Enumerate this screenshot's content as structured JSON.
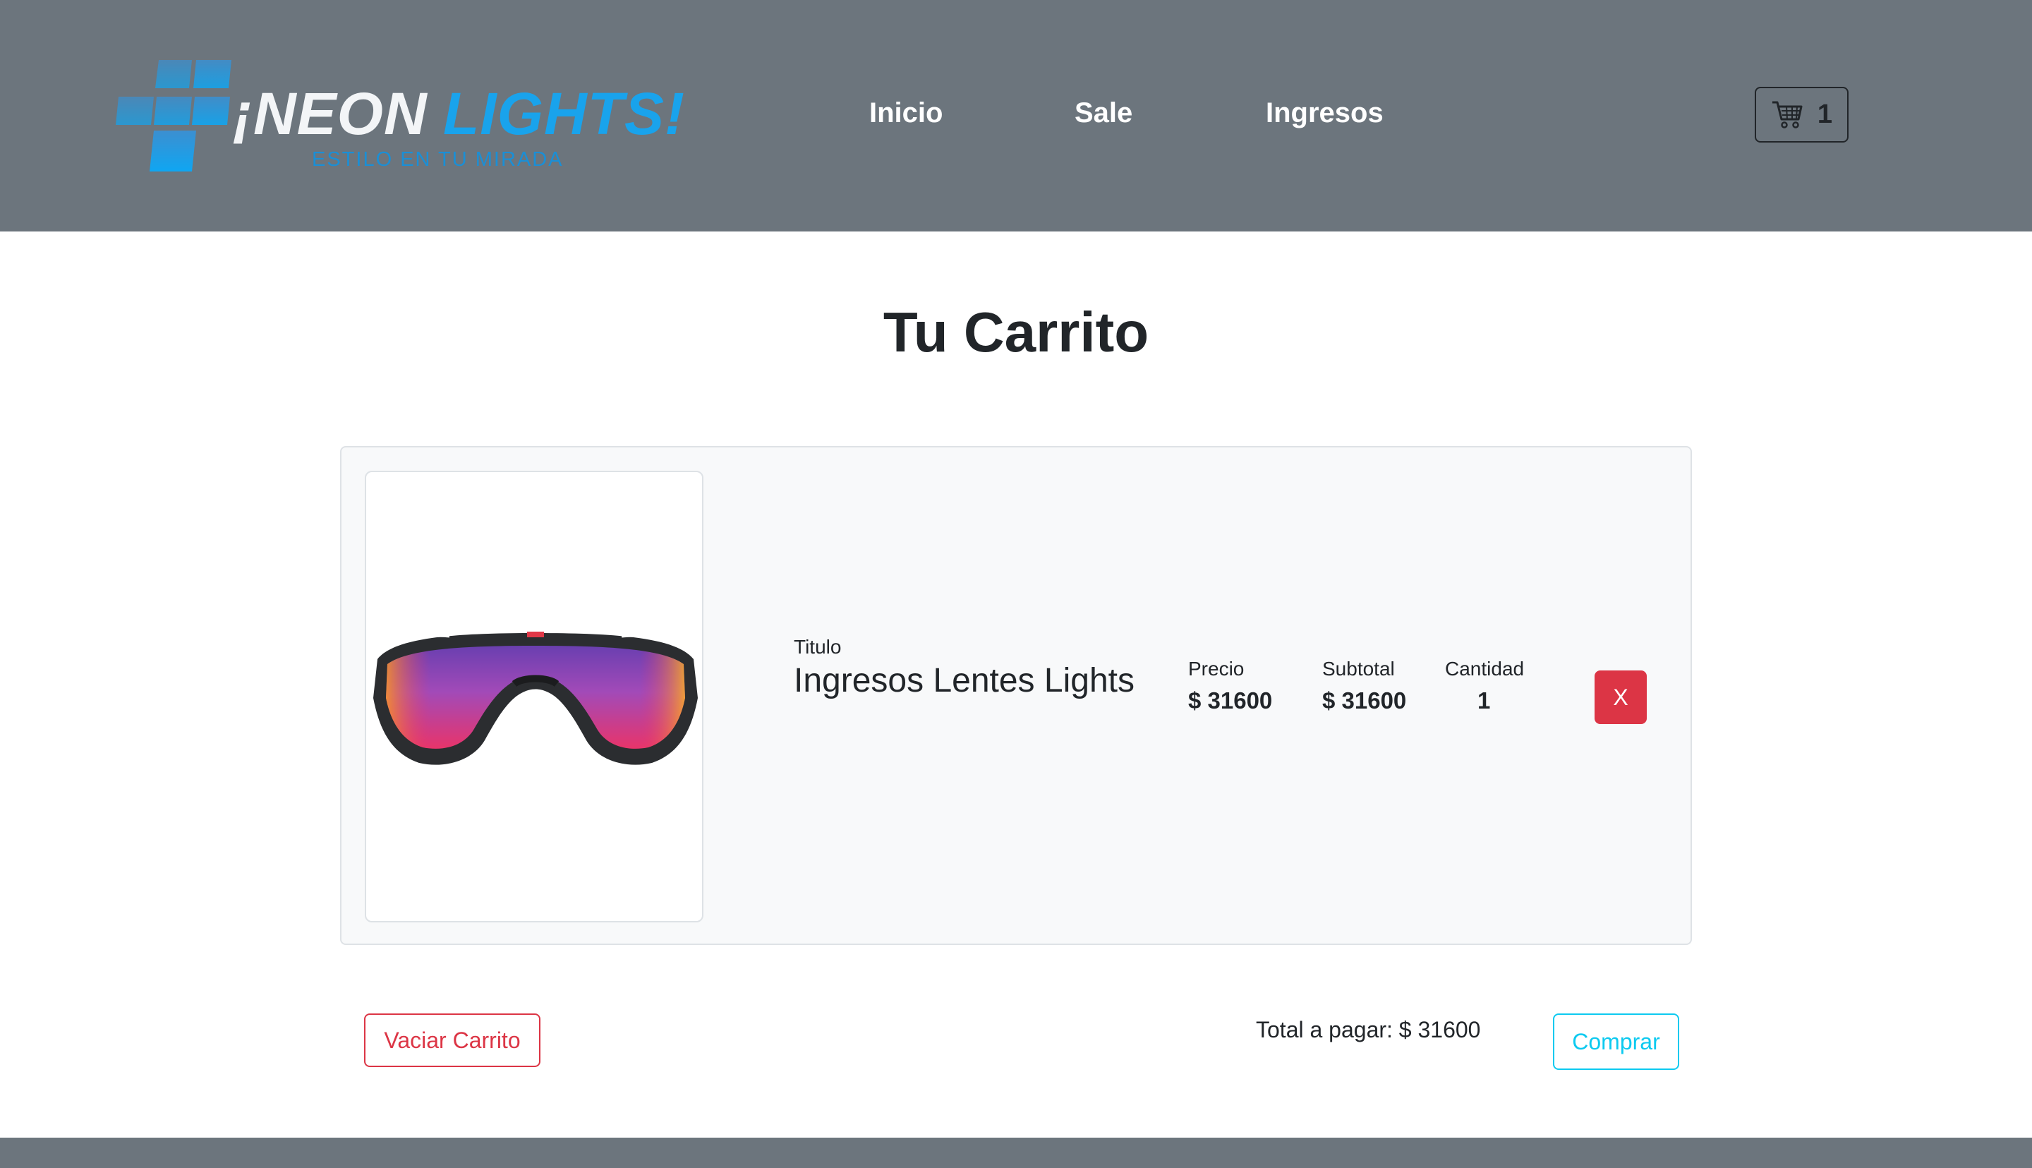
{
  "colors": {
    "navbar_bg": "#6c757d",
    "brand_blue": "#19a3ec",
    "danger": "#dc3545",
    "info": "#0dcaf0",
    "card_bg": "#f8f9fa"
  },
  "brand": {
    "name_white": "¡NEON",
    "name_blue": "LIGHTS!",
    "tagline": "ESTILO EN TU MIRADA"
  },
  "nav": {
    "links": [
      {
        "label": "Inicio"
      },
      {
        "label": "Sale"
      },
      {
        "label": "Ingresos"
      }
    ],
    "cart": {
      "icon": "shopping-cart-icon",
      "count": "1"
    }
  },
  "page": {
    "title": "Tu Carrito"
  },
  "cart_items": [
    {
      "image": "sunglasses-product-image",
      "title_label": "Titulo",
      "title": "Ingresos Lentes Lights",
      "price_label": "Precio",
      "price": "$ 31600",
      "subtotal_label": "Subtotal",
      "subtotal": "$ 31600",
      "quantity_label": "Cantidad",
      "quantity": "1",
      "remove_label": "X"
    }
  ],
  "actions": {
    "empty_label": "Vaciar Carrito",
    "total_text": "Total a pagar: $ 31600",
    "buy_label": "Comprar"
  }
}
